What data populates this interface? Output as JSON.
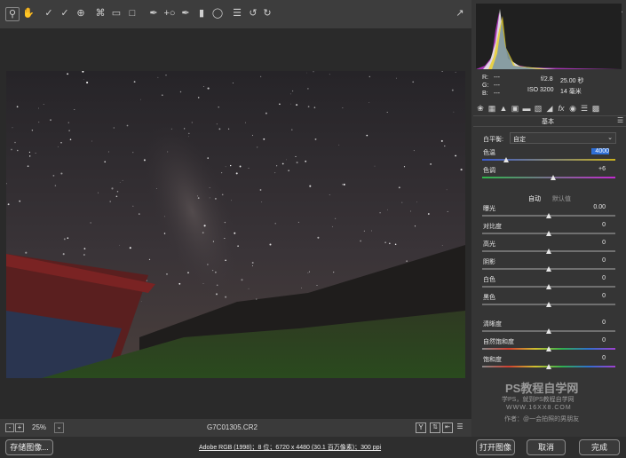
{
  "toolbar": {
    "tools": [
      "zoom-icon",
      "hand-icon",
      "white-balance-icon",
      "color-sampler-icon",
      "targeted-adjust-icon",
      "crop-icon",
      "straighten-icon",
      "transform-icon",
      "spot-removal-icon",
      "red-eye-icon",
      "adjustment-brush-icon",
      "graduated-filter-icon",
      "radial-filter-icon",
      "presets-icon",
      "rotate-left-icon",
      "rotate-right-icon"
    ],
    "toggle_fullscreen_icon": "fullscreen-icon"
  },
  "histogram": {
    "r_label": "R:",
    "r_value": "---",
    "g_label": "G:",
    "g_value": "---",
    "b_label": "B:",
    "b_value": "---",
    "aperture": "f/2.8",
    "shutter": "25.00 秒",
    "iso": "ISO 3200",
    "focal": "14 毫米"
  },
  "panel": {
    "section_title": "基本",
    "wb_label": "白平衡:",
    "wb_value": "自定",
    "auto_label": "自动",
    "default_label": "默认值",
    "sliders": [
      {
        "label": "色温",
        "value": "4000",
        "level": 0.18
      },
      {
        "label": "色调",
        "value": "+6",
        "level": 0.53
      },
      {
        "label": "曝光",
        "value": "0.00",
        "level": 0.5
      },
      {
        "label": "对比度",
        "value": "0",
        "level": 0.5
      },
      {
        "label": "高光",
        "value": "0",
        "level": 0.5
      },
      {
        "label": "阴影",
        "value": "0",
        "level": 0.5
      },
      {
        "label": "白色",
        "value": "0",
        "level": 0.5
      },
      {
        "label": "黑色",
        "value": "0",
        "level": 0.5
      },
      {
        "label": "清晰度",
        "value": "0",
        "level": 0.5
      },
      {
        "label": "自然饱和度",
        "value": "0",
        "level": 0.5
      },
      {
        "label": "饱和度",
        "value": "0",
        "level": 0.5
      }
    ]
  },
  "status": {
    "zoom": "25%",
    "filename": "G7C01305.CR2",
    "view_y": "Y"
  },
  "watermark": {
    "line1": "PS教程自学网",
    "line2": "学PS，就到PS教程自学网",
    "line3": "WWW.16XX8.COM",
    "line4": "作者：@一会拍照的男朋友"
  },
  "bottom": {
    "save_label": "存储图像...",
    "info_link": "Adobe RGB (1998)；8 位；6720 x 4480 (30.1 百万像素)；300 ppi",
    "open_label": "打开图像",
    "cancel_label": "取消",
    "done_label": "完成"
  },
  "colors": {
    "accent": "#2f6fd6",
    "highlight": "#4d8ef0"
  }
}
